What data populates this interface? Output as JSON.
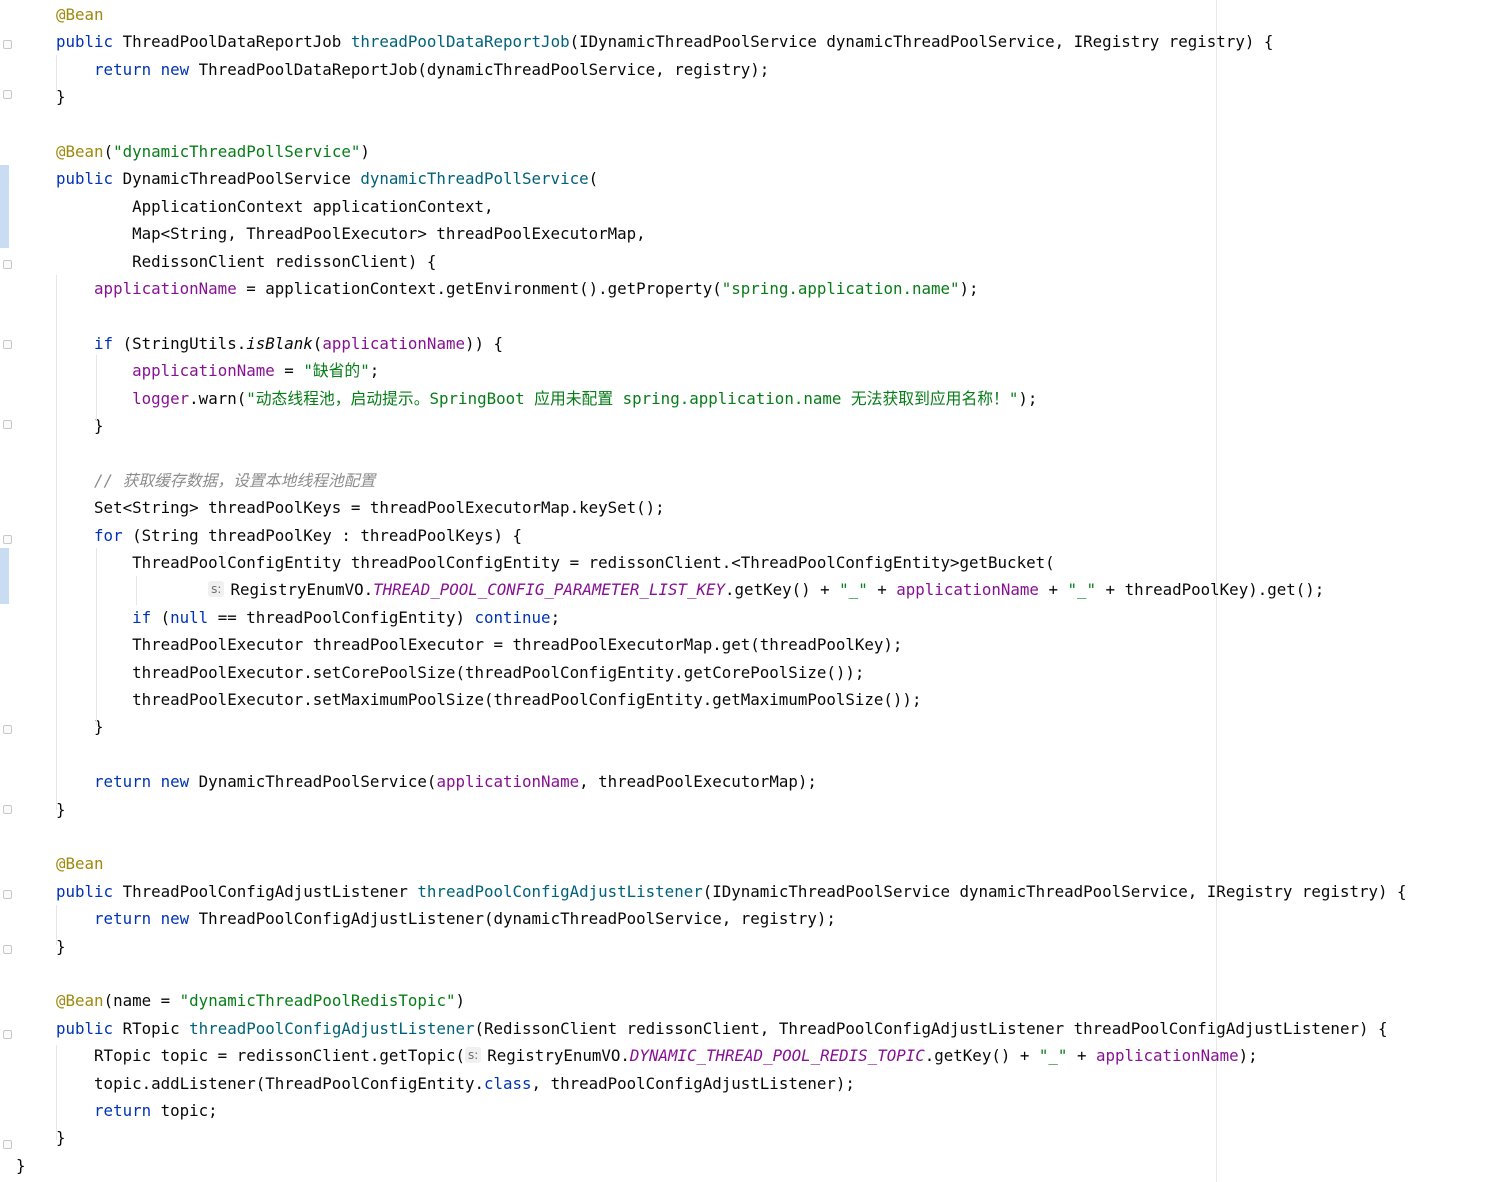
{
  "editor": {
    "lines": [
      [
        [
          "@Bean",
          "ann"
        ]
      ],
      [
        [
          "public ",
          "kw"
        ],
        [
          "ThreadPoolDataReportJob ",
          ""
        ],
        [
          "threadPoolDataReportJob",
          "m"
        ],
        [
          "(IDynamicThreadPoolService dynamicThreadPoolService, IRegistry registry) {",
          ""
        ]
      ],
      [
        [
          "    return new ",
          "kw"
        ],
        [
          "ThreadPoolDataReportJob(dynamicThreadPoolService, registry);",
          ""
        ]
      ],
      [
        [
          "}",
          ""
        ]
      ],
      [],
      [
        [
          "@Bean",
          "ann"
        ],
        [
          "(",
          ""
        ],
        [
          "\"dynamicThreadPollService\"",
          "s"
        ],
        [
          ")",
          ""
        ]
      ],
      [
        [
          "public ",
          "kw"
        ],
        [
          "DynamicThreadPoolService ",
          ""
        ],
        [
          "dynamicThreadPollService",
          "m"
        ],
        [
          "(",
          ""
        ]
      ],
      [
        [
          "        ApplicationContext applicationContext,",
          ""
        ]
      ],
      [
        [
          "        Map<String, ThreadPoolExecutor> threadPoolExecutorMap,",
          ""
        ]
      ],
      [
        [
          "        RedissonClient redissonClient) {",
          ""
        ]
      ],
      [
        [
          "    ",
          ""
        ],
        [
          "applicationName",
          "f"
        ],
        [
          " = applicationContext.getEnvironment().getProperty(",
          ""
        ],
        [
          "\"spring.application.name\"",
          "s"
        ],
        [
          ");",
          ""
        ]
      ],
      [],
      [
        [
          "    if ",
          "kw"
        ],
        [
          "(StringUtils.",
          ""
        ],
        [
          "isBlank",
          "i"
        ],
        [
          "(",
          ""
        ],
        [
          "applicationName",
          "f"
        ],
        [
          ")) {",
          ""
        ]
      ],
      [
        [
          "        ",
          ""
        ],
        [
          "applicationName",
          "f"
        ],
        [
          " = ",
          ""
        ],
        [
          "\"缺省的\"",
          "s"
        ],
        [
          ";",
          ""
        ]
      ],
      [
        [
          "        ",
          ""
        ],
        [
          "logger",
          "f"
        ],
        [
          ".warn(",
          ""
        ],
        [
          "\"动态线程池，启动提示。SpringBoot 应用未配置 spring.application.name 无法获取到应用名称！\"",
          "s"
        ],
        [
          ");",
          ""
        ]
      ],
      [
        [
          "    }",
          ""
        ]
      ],
      [],
      [
        [
          "    // 获取缓存数据，设置本地线程池配置",
          "c"
        ]
      ],
      [
        [
          "    Set<String> threadPoolKeys = threadPoolExecutorMap.keySet();",
          ""
        ]
      ],
      [
        [
          "    for ",
          "kw"
        ],
        [
          "(String threadPoolKey : threadPoolKeys) {",
          ""
        ]
      ],
      [
        [
          "        ThreadPoolConfigEntity threadPoolConfigEntity = redissonClient.<ThreadPoolConfigEntity>getBucket(",
          ""
        ]
      ],
      [
        [
          "                ",
          ""
        ],
        [
          "s:",
          "hint"
        ],
        [
          "RegistryEnumVO.",
          ""
        ],
        [
          "THREAD_POOL_CONFIG_PARAMETER_LIST_KEY",
          "st"
        ],
        [
          ".getKey() + ",
          ""
        ],
        [
          "\"_\"",
          "s"
        ],
        [
          " + ",
          ""
        ],
        [
          "applicationName",
          "f"
        ],
        [
          " + ",
          ""
        ],
        [
          "\"_\"",
          "s"
        ],
        [
          " + threadPoolKey).get();",
          ""
        ]
      ],
      [
        [
          "        if ",
          "kw"
        ],
        [
          "(",
          ""
        ],
        [
          "null",
          "kw"
        ],
        [
          " == threadPoolConfigEntity) ",
          ""
        ],
        [
          "continue",
          "kw"
        ],
        [
          ";",
          ""
        ]
      ],
      [
        [
          "        ThreadPoolExecutor threadPoolExecutor = threadPoolExecutorMap.get(threadPoolKey);",
          ""
        ]
      ],
      [
        [
          "        threadPoolExecutor.setCorePoolSize(threadPoolConfigEntity.getCorePoolSize());",
          ""
        ]
      ],
      [
        [
          "        threadPoolExecutor.setMaximumPoolSize(threadPoolConfigEntity.getMaximumPoolSize());",
          ""
        ]
      ],
      [
        [
          "    }",
          ""
        ]
      ],
      [],
      [
        [
          "    return new ",
          "kw"
        ],
        [
          "DynamicThreadPoolService(",
          ""
        ],
        [
          "applicationName",
          "f"
        ],
        [
          ", threadPoolExecutorMap);",
          ""
        ]
      ],
      [
        [
          "}",
          ""
        ]
      ],
      [],
      [
        [
          "@Bean",
          "ann"
        ]
      ],
      [
        [
          "public ",
          "kw"
        ],
        [
          "ThreadPoolConfigAdjustListener ",
          ""
        ],
        [
          "threadPoolConfigAdjustListener",
          "m"
        ],
        [
          "(IDynamicThreadPoolService dynamicThreadPoolService, IRegistry registry) {",
          ""
        ]
      ],
      [
        [
          "    return new ",
          "kw"
        ],
        [
          "ThreadPoolConfigAdjustListener(dynamicThreadPoolService, registry);",
          ""
        ]
      ],
      [
        [
          "}",
          ""
        ]
      ],
      [],
      [
        [
          "@Bean",
          "ann"
        ],
        [
          "(name = ",
          ""
        ],
        [
          "\"dynamicThreadPoolRedisTopic\"",
          "s"
        ],
        [
          ")",
          ""
        ]
      ],
      [
        [
          "public ",
          "kw"
        ],
        [
          "RTopic ",
          ""
        ],
        [
          "threadPoolConfigAdjustListener",
          "m"
        ],
        [
          "(RedissonClient redissonClient, ThreadPoolConfigAdjustListener threadPoolConfigAdjustListener) {",
          ""
        ]
      ],
      [
        [
          "    RTopic topic = redissonClient.getTopic(",
          ""
        ],
        [
          "s:",
          "hint"
        ],
        [
          "RegistryEnumVO.",
          ""
        ],
        [
          "DYNAMIC_THREAD_POOL_REDIS_TOPIC",
          "st"
        ],
        [
          ".getKey() + ",
          ""
        ],
        [
          "\"_\"",
          "s"
        ],
        [
          " + ",
          ""
        ],
        [
          "applicationName",
          "f"
        ],
        [
          ");",
          ""
        ]
      ],
      [
        [
          "    topic.addListener(ThreadPoolConfigEntity.",
          ""
        ],
        [
          "class",
          "kw"
        ],
        [
          ", threadPoolConfigAdjustListener);",
          ""
        ]
      ],
      [
        [
          "    return ",
          "kw"
        ],
        [
          "topic;",
          ""
        ]
      ],
      [
        [
          "}",
          ""
        ]
      ],
      [
        [
          "}",
          ""
        ]
      ]
    ]
  }
}
